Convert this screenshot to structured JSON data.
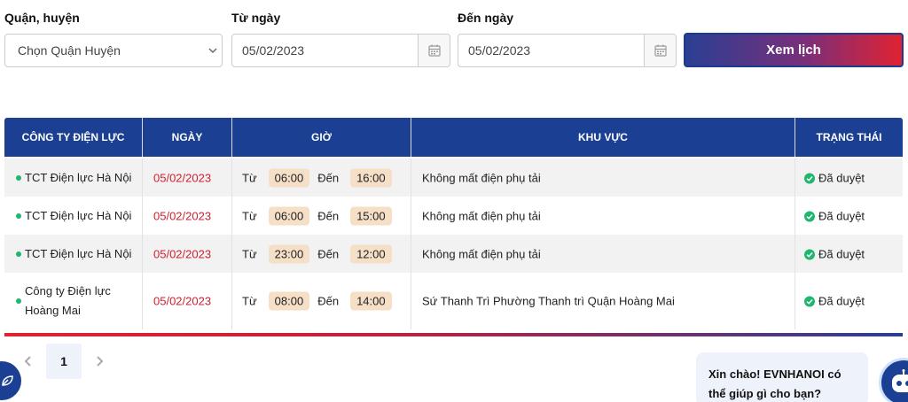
{
  "filters": {
    "district_label": "Quận, huyện",
    "district_value": "Chọn Quận Huyện",
    "from_label": "Từ ngày",
    "from_value": "05/02/2023",
    "to_label": "Đến ngày",
    "to_value": "05/02/2023",
    "view_button": "Xem lịch"
  },
  "table": {
    "headers": {
      "company": "CÔNG TY ĐIỆN LỰC",
      "date": "NGÀY",
      "time": "GIỜ",
      "area": "KHU VỰC",
      "status": "TRẠNG THÁI"
    },
    "from_word": "Từ",
    "to_word": "Đến",
    "rows": [
      {
        "company": "TCT Điện lực Hà Nội",
        "date": "05/02/2023",
        "start": "06:00",
        "end": "16:00",
        "area": "Không mất điện phụ tải",
        "status": "Đã duyệt"
      },
      {
        "company": "TCT Điện lực Hà Nội",
        "date": "05/02/2023",
        "start": "06:00",
        "end": "15:00",
        "area": "Không mất điện phụ tải",
        "status": "Đã duyệt"
      },
      {
        "company": "TCT Điện lực Hà Nội",
        "date": "05/02/2023",
        "start": "23:00",
        "end": "12:00",
        "area": "Không mất điện phụ tải",
        "status": "Đã duyệt"
      },
      {
        "company_line1": "Công ty Điện lực",
        "company_line2": "Hoàng Mai",
        "date": "05/02/2023",
        "start": "08:00",
        "end": "14:00",
        "area": "Sứ Thanh Trì Phường Thanh trì Quận Hoàng Mai",
        "status": "Đã duyệt"
      }
    ]
  },
  "pagination": {
    "current": "1"
  },
  "chat": {
    "line1": "Xin chào! EVNHANOI có",
    "line2": "thể giúp gì cho bạn?"
  },
  "colors": {
    "header_blue": "#1a3f93",
    "accent_red": "#e02232",
    "status_green": "#21b66d",
    "chip_bg": "#f6dfc7"
  }
}
